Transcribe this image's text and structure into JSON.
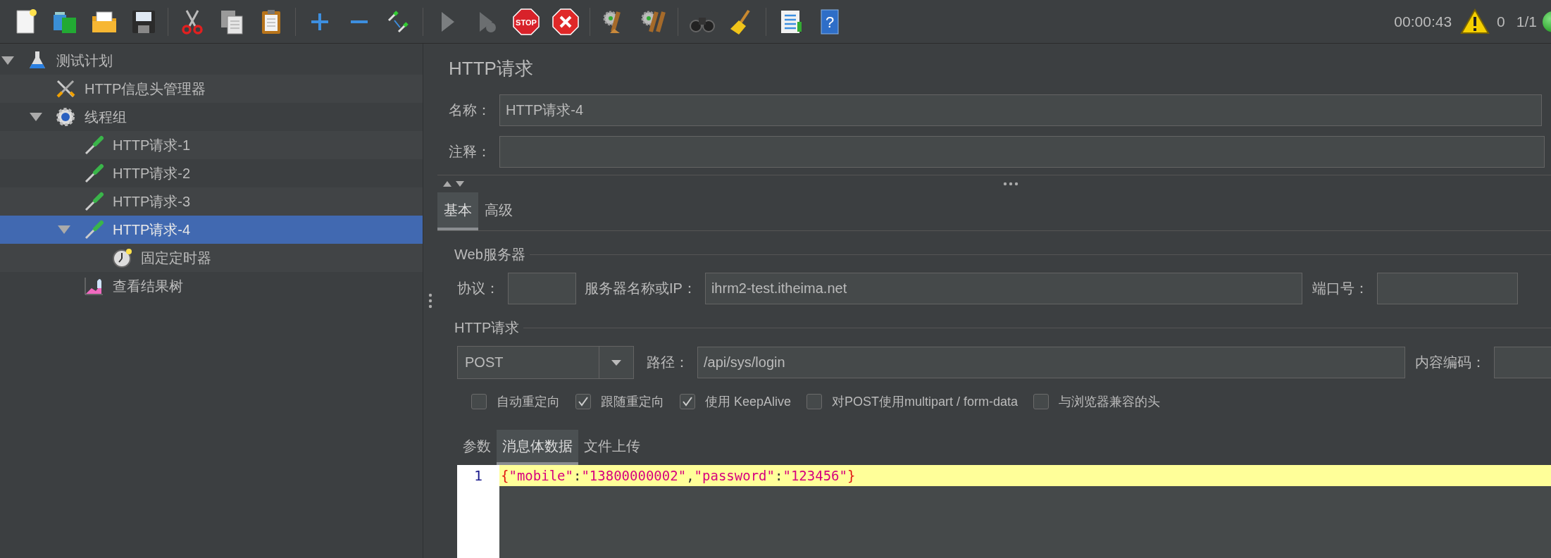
{
  "toolbar": {
    "stop_label": "STOP",
    "help_mark": "?",
    "timer": "00:00:43",
    "warning_count": "0",
    "threads": "1/1"
  },
  "tree": [
    {
      "label": "测试计划",
      "kind": "plan",
      "expanded": true,
      "selected": false,
      "children": [
        {
          "label": "HTTP信息头管理器",
          "kind": "config",
          "selected": false
        },
        {
          "label": "线程组",
          "kind": "thread_group",
          "expanded": true,
          "selected": false,
          "children": [
            {
              "label": "HTTP请求-1",
              "kind": "sampler",
              "selected": false
            },
            {
              "label": "HTTP请求-2",
              "kind": "sampler",
              "selected": false
            },
            {
              "label": "HTTP请求-3",
              "kind": "sampler",
              "selected": false
            },
            {
              "label": "HTTP请求-4",
              "kind": "sampler",
              "expanded": true,
              "selected": true,
              "children": [
                {
                  "label": "固定定时器",
                  "kind": "timer",
                  "selected": false
                }
              ]
            },
            {
              "label": "查看结果树",
              "kind": "listener",
              "selected": false
            }
          ]
        }
      ]
    }
  ],
  "panel": {
    "title": "HTTP请求",
    "name_label": "名称：",
    "name_value": "HTTP请求-4",
    "comment_label": "注释："
  },
  "tabs": [
    {
      "label": "基本",
      "selected": true
    },
    {
      "label": "高级",
      "selected": false
    }
  ],
  "web_server": {
    "legend": "Web服务器",
    "protocol_label": "协议：",
    "server_label": "服务器名称或IP：",
    "server_value": "ihrm2-test.itheima.net",
    "port_label": "端口号："
  },
  "http_request": {
    "legend": "HTTP请求",
    "method": "POST",
    "path_label": "路径：",
    "path_value": "/api/sys/login",
    "encoding_label": "内容编码："
  },
  "checkboxes": [
    {
      "label": "自动重定向",
      "checked": false
    },
    {
      "label": "跟随重定向",
      "checked": true
    },
    {
      "label": "使用 KeepAlive",
      "checked": true
    },
    {
      "label": "对POST使用multipart / form-data",
      "checked": false
    },
    {
      "label": "与浏览器兼容的头",
      "checked": false
    }
  ],
  "body_tabs": [
    {
      "label": "参数",
      "selected": false
    },
    {
      "label": "消息体数据",
      "selected": true
    },
    {
      "label": "文件上传",
      "selected": false
    }
  ],
  "editor": {
    "lines": [
      {
        "number": "1",
        "code": "{\"mobile\":\"13800000002\",\"password\":\"123456\"}",
        "highlighted": true
      }
    ]
  }
}
